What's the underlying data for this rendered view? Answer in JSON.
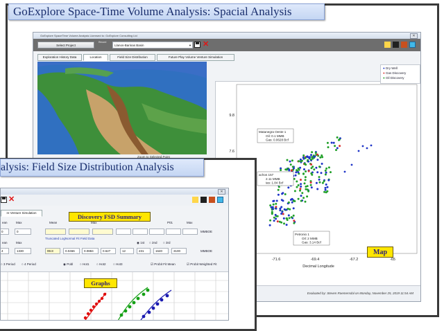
{
  "map_window": {
    "banner": "GoExplore  Space-Time Volume Analysis:   Spacial Analysis",
    "title": "GoExplore SpaceTime Volume Analysis   Licensed to:  GoExplore Consulting Ltd",
    "select_project": "Select Project",
    "record_label": "Record",
    "basin": "Llanos-Barinas Basin",
    "tabs": [
      "Exploration History Data",
      "Location",
      "Field Size Distribution",
      "Future Play Volume Venture Simulation"
    ],
    "active_tab": 1,
    "zoom_label": "Zoom to Selected Point",
    "legend": [
      "Dry Well",
      "Gas Discovery",
      "Oil Discovery"
    ],
    "y_ticks": [
      "9.8",
      "7.6"
    ],
    "x_ticks": [
      "-71.6",
      "-69.4",
      "-67.2",
      "-65"
    ],
    "x_tick_partial": "5",
    "xlabel": "Decimal Longitude",
    "annotations": [
      {
        "l1": "Matanegra Oeste 1",
        "l2": "Oil: 0.1 MMB",
        "l3": "Gas: 0.0628 Bcf"
      },
      {
        "l1": "achos 157",
        "l2": "2.11 MMB",
        "l3": "ias: 1.84 Bcf"
      },
      {
        "l1": "Petronio 1",
        "l2": "Oil: 2 MMB",
        "l3": "Gas: 3.14 Bcf"
      }
    ],
    "map_badge": "Map",
    "footer": "Evaluated by:  Steven Roemersdal  on  Monday, November 25, 2019 11:54 AM",
    "colors": {
      "dry": "#1f35c8",
      "gas": "#d93030",
      "oil": "#22a02a"
    }
  },
  "fsd_window": {
    "banner": "alysis:   Field Size Distribution Analysis",
    "tab_partial": "re Venture Simulation",
    "summary_title": "Discovery FSD Summary",
    "header_row": [
      "ean",
      "Max",
      "Mean",
      "Max",
      "P01",
      "Max"
    ],
    "row1": [
      "0",
      "0"
    ],
    "unit": "MMBOE",
    "truncated_label": "Truncated LogNormal Fit Field Data",
    "radios_mid": [
      "1st",
      "2nd",
      "3rd"
    ],
    "mid_header": [
      "ean",
      "Max"
    ],
    "row2": [
      "4",
      "1330",
      "99.8",
      "0.0466",
      "0.0884",
      "0.627",
      "12",
      "231",
      "1640",
      "3100"
    ],
    "period_radios": [
      "3 Period",
      "4 Period"
    ],
    "fit_radios": [
      "Pobl",
      "Hot1",
      "Hot2",
      "Hot3"
    ],
    "checks": [
      "Probit Fit Mean",
      "Probit Weighted Fit"
    ],
    "graphs_label": "Graphs",
    "colors": {
      "red": "#e01010",
      "green": "#14a014",
      "blue": "#1a1ab0"
    }
  }
}
